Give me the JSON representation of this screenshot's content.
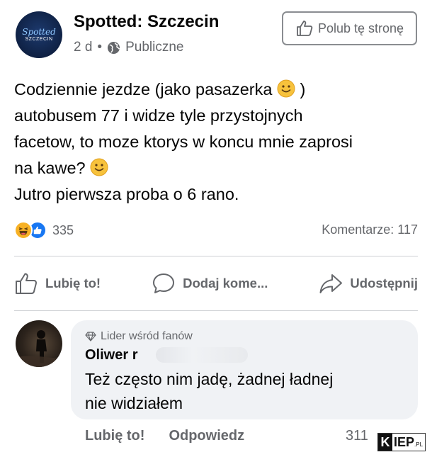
{
  "post": {
    "page_name": "Spotted: Szczecin",
    "avatar_logo_top": "Spotted",
    "avatar_logo_bottom": "SZCZECIN",
    "time": "2 d",
    "separator": "•",
    "audience": "Publiczne",
    "audience_icon": "globe-icon",
    "like_page_label": "Polub tę stronę",
    "text_lines": [
      "Codziennie jezdze (jako pasazerka",
      ")",
      "autobusem 77 i widze tyle przystojnych",
      "facetow, to moze ktorys w koncu mnie zaprosi",
      "na kawe?",
      "Jutro pierwsza proba o 6 rano."
    ],
    "emoji_name": "slightly-smiling-face"
  },
  "stats": {
    "reaction_types": [
      "haha",
      "like"
    ],
    "reaction_count": "335",
    "comments_label": "Komentarze: 117"
  },
  "actions": {
    "like": "Lubię to!",
    "comment": "Dodaj kome...",
    "share": "Udostępnij"
  },
  "comment": {
    "badge": "Lider wśród fanów",
    "badge_icon": "diamond-icon",
    "author": "Oliwer",
    "author_initial": "r",
    "text_line1": "Też często nim jadę, żadnej ładnej",
    "text_line2": "nie widziałem",
    "like_label": "Lubię to!",
    "reply_label": "Odpowiedz",
    "likes_count": "311"
  },
  "watermark": {
    "k": "K",
    "rest": "IEP",
    "tld": ".PL"
  },
  "colors": {
    "brand_blue": "#1877f2",
    "secondary_text": "#65676b",
    "bubble_bg": "#f0f2f5",
    "haha_yellow": "#f7b125"
  }
}
